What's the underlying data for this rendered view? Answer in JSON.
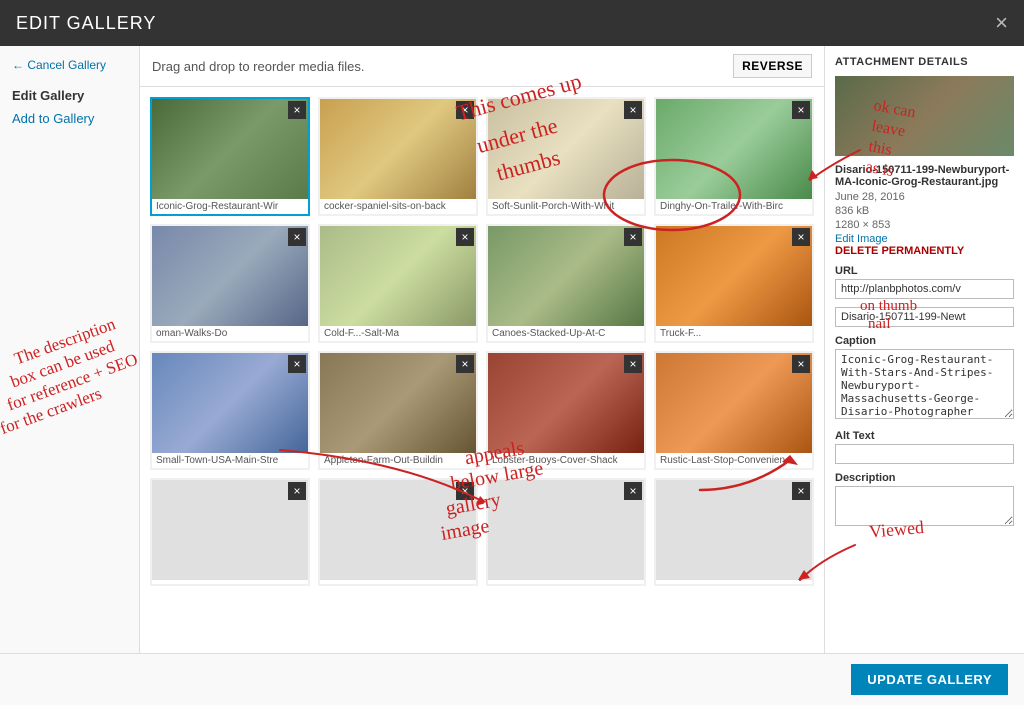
{
  "modal": {
    "title": "Edit Gallery",
    "close_label": "×"
  },
  "sidebar": {
    "cancel_label": "← Cancel Gallery",
    "nav_items": [
      {
        "label": "Edit Gallery",
        "active": true
      },
      {
        "label": "Add to Gallery",
        "active": false
      }
    ]
  },
  "toolbar": {
    "instruction": "Drag and drop to reorder media files.",
    "reverse_label": "REVERSE"
  },
  "gallery_items": [
    {
      "id": 1,
      "label": "Iconic-Grog-Restaurant-Wir",
      "selected": true,
      "color": "#5a7a5a"
    },
    {
      "id": 2,
      "label": "cocker-spaniel-sits-on-back",
      "selected": false,
      "color": "#c8a86a"
    },
    {
      "id": 3,
      "label": "Soft-Sunlit-Porch-With-Whit",
      "selected": false,
      "color": "#d4c090"
    },
    {
      "id": 4,
      "label": "Dinghy-On-Trailer-With-Birc",
      "selected": false,
      "color": "#7aaa7a"
    },
    {
      "id": 5,
      "label": "oman-Walks-Do",
      "selected": false,
      "color": "#8899aa"
    },
    {
      "id": 6,
      "label": "Cold-F...-Salt-Ma",
      "selected": false,
      "color": "#aabb99"
    },
    {
      "id": 7,
      "label": "Canoes-Stacked-Up-At-C",
      "selected": false,
      "color": "#88aa66"
    },
    {
      "id": 8,
      "label": "Truck-F...",
      "selected": false,
      "color": "#cc8833"
    },
    {
      "id": 9,
      "label": "Small-Town-USA-Main-Stre",
      "selected": false,
      "color": "#7799bb"
    },
    {
      "id": 10,
      "label": "Appleton-Farm-Out-Buildin",
      "selected": false,
      "color": "#998877"
    },
    {
      "id": 11,
      "label": "Lobster-Buoys-Cover-Shack",
      "selected": false,
      "color": "#aa6655"
    },
    {
      "id": 12,
      "label": "Rustic-Last-Stop-Convenien",
      "selected": false,
      "color": "#cc8844"
    },
    {
      "id": 13,
      "label": "",
      "selected": false,
      "color": "#ddd"
    },
    {
      "id": 14,
      "label": "",
      "selected": false,
      "color": "#ddd"
    },
    {
      "id": 15,
      "label": "",
      "selected": false,
      "color": "#ddd"
    },
    {
      "id": 16,
      "label": "",
      "selected": false,
      "color": "#ddd"
    }
  ],
  "attachment": {
    "section_title": "Attachment Details",
    "filename": "Disario-150711-199-Newburyport-MA-Iconic-Grog-Restaurant.jpg",
    "date": "June 28, 2016",
    "filesize": "836 kB",
    "dimensions": "1280 × 853",
    "edit_label": "Edit Image",
    "delete_label": "DELETE PERMANENTLY",
    "url_label": "URL",
    "url_value": "http://planbphotos.com/v",
    "filename_label": "",
    "filename_value": "Disario-150711-199-Newt",
    "caption_label": "Caption",
    "caption_value": "Iconic-Grog-Restaurant-With-Stars-And-Stripes-Newburyport-Massachusetts-George-Disario-Photographer",
    "alt_label": "Alt Text",
    "alt_value": "",
    "description_label": "Description",
    "description_value": ""
  },
  "footer": {
    "update_label": "UPDATE GALLERY"
  }
}
